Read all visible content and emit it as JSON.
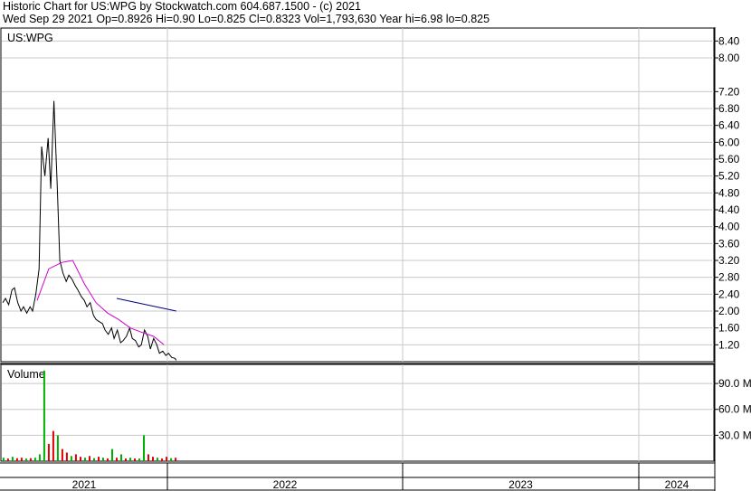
{
  "header": {
    "line1": "Historic Chart for US:WPG by Stockwatch.com 604.687.1500 - (c) 2021",
    "line2": "Wed Sep 29 2021   Op=0.8926  Hi=0.90  Lo=0.825  Cl=0.8323  Vol=1,793,630   Year hi=6.98  lo=0.825"
  },
  "colors": {
    "price": "#000000",
    "ma_long": "#d000d0",
    "ma_short": "#000080",
    "volume_up": "#00b000",
    "volume_down": "#e00000",
    "grid": "#c8c8c8"
  },
  "chart_data": [
    {
      "type": "line",
      "title": "US:WPG",
      "ylabel": "",
      "xlabel": "",
      "y_ticks": [
        "8.40",
        "8.00",
        "7.20",
        "6.80",
        "6.40",
        "6.00",
        "5.60",
        "5.20",
        "4.80",
        "4.40",
        "4.00",
        "3.60",
        "3.20",
        "2.80",
        "2.40",
        "2.00",
        "1.60",
        "1.20"
      ],
      "ylim": [
        0.8,
        8.6
      ],
      "x_ticks": [
        "2021",
        "2022",
        "2023",
        "2024"
      ],
      "series": [
        {
          "name": "",
          "color": "#000000",
          "x": [
            "2021-01-04",
            "2021-01-08",
            "2021-01-13",
            "2021-01-18",
            "2021-01-22",
            "2021-01-27",
            "2021-02-01",
            "2021-02-05",
            "2021-02-10",
            "2021-02-15",
            "2021-02-19",
            "2021-02-24",
            "2021-03-01",
            "2021-03-05",
            "2021-03-10",
            "2021-03-15",
            "2021-03-19",
            "2021-03-24",
            "2021-03-29",
            "2021-04-02",
            "2021-04-07",
            "2021-04-12",
            "2021-04-16",
            "2021-04-21",
            "2021-04-26",
            "2021-04-30",
            "2021-05-05",
            "2021-05-10",
            "2021-05-14",
            "2021-05-19",
            "2021-05-24",
            "2021-05-28",
            "2021-06-02",
            "2021-06-07",
            "2021-06-11",
            "2021-06-16",
            "2021-06-21",
            "2021-06-25",
            "2021-06-30",
            "2021-07-05",
            "2021-07-09",
            "2021-07-14",
            "2021-07-19",
            "2021-07-23",
            "2021-07-28",
            "2021-08-02",
            "2021-08-06",
            "2021-08-11",
            "2021-08-16",
            "2021-08-20",
            "2021-08-25",
            "2021-08-30",
            "2021-09-03",
            "2021-09-08",
            "2021-09-13",
            "2021-09-17",
            "2021-09-22",
            "2021-09-27",
            "2021-09-29"
          ],
          "values": [
            2.2,
            2.3,
            2.15,
            2.5,
            2.55,
            2.2,
            2.0,
            2.1,
            1.95,
            2.1,
            2.0,
            2.4,
            3.0,
            5.9,
            5.2,
            6.1,
            4.9,
            6.98,
            5.0,
            3.2,
            2.9,
            2.7,
            2.85,
            2.75,
            2.6,
            2.5,
            2.35,
            2.25,
            2.1,
            2.2,
            1.9,
            1.8,
            1.75,
            1.7,
            1.55,
            1.45,
            1.6,
            1.35,
            1.55,
            1.25,
            1.3,
            1.4,
            1.6,
            1.35,
            1.3,
            1.15,
            1.2,
            1.55,
            1.4,
            1.1,
            1.35,
            1.2,
            1.0,
            1.05,
            0.95,
            1.0,
            0.9,
            0.88,
            0.8323
          ]
        },
        {
          "name": "",
          "color": "#d000d0",
          "x": [
            "2021-02-26",
            "2021-03-16",
            "2021-04-05",
            "2021-04-22",
            "2021-05-10",
            "2021-05-28",
            "2021-06-15",
            "2021-07-02",
            "2021-07-20",
            "2021-08-06",
            "2021-08-25",
            "2021-09-10"
          ],
          "values": [
            2.25,
            3.0,
            3.15,
            3.2,
            2.65,
            2.2,
            1.95,
            1.8,
            1.6,
            1.5,
            1.4,
            1.2
          ]
        },
        {
          "name": "",
          "color": "#000080",
          "x": [
            "2021-06-29",
            "2021-09-29"
          ],
          "values": [
            2.3,
            2.0
          ]
        }
      ]
    },
    {
      "type": "bar",
      "title": "Volume",
      "y_ticks": [
        "90.0 M",
        "60.0 M",
        "30.0 M"
      ],
      "ylim": [
        0,
        110000000
      ],
      "x_ticks": [
        "2021",
        "2022",
        "2023",
        "2024"
      ],
      "series": [
        {
          "name": "",
          "x": [
            "2021-01-05",
            "2021-01-12",
            "2021-01-19",
            "2021-01-26",
            "2021-02-02",
            "2021-02-09",
            "2021-02-16",
            "2021-02-23",
            "2021-03-02",
            "2021-03-09",
            "2021-03-16",
            "2021-03-23",
            "2021-03-30",
            "2021-04-06",
            "2021-04-13",
            "2021-04-20",
            "2021-04-27",
            "2021-05-04",
            "2021-05-11",
            "2021-05-18",
            "2021-05-25",
            "2021-06-01",
            "2021-06-08",
            "2021-06-15",
            "2021-06-22",
            "2021-06-29",
            "2021-07-06",
            "2021-07-13",
            "2021-07-20",
            "2021-07-27",
            "2021-08-03",
            "2021-08-10",
            "2021-08-17",
            "2021-08-24",
            "2021-08-31",
            "2021-09-07",
            "2021-09-14",
            "2021-09-21",
            "2021-09-28"
          ],
          "values": [
            4000000,
            3000000,
            5000000,
            3500000,
            4000000,
            3000000,
            3500000,
            4000000,
            8000000,
            105000000,
            20000000,
            35000000,
            30000000,
            14000000,
            10000000,
            6000000,
            8000000,
            5000000,
            4000000,
            6000000,
            3500000,
            5000000,
            4000000,
            3000000,
            14000000,
            4000000,
            8000000,
            3000000,
            4000000,
            3000000,
            3000000,
            30000000,
            8000000,
            5000000,
            4000000,
            3000000,
            5000000,
            3500000,
            4000000
          ],
          "direction": [
            "up",
            "down",
            "up",
            "down",
            "down",
            "up",
            "down",
            "up",
            "up",
            "up",
            "down",
            "down",
            "up",
            "down",
            "down",
            "up",
            "down",
            "down",
            "up",
            "down",
            "up",
            "down",
            "up",
            "down",
            "up",
            "down",
            "up",
            "down",
            "up",
            "down",
            "up",
            "up",
            "down",
            "down",
            "up",
            "down",
            "down",
            "up",
            "down"
          ]
        }
      ]
    }
  ]
}
